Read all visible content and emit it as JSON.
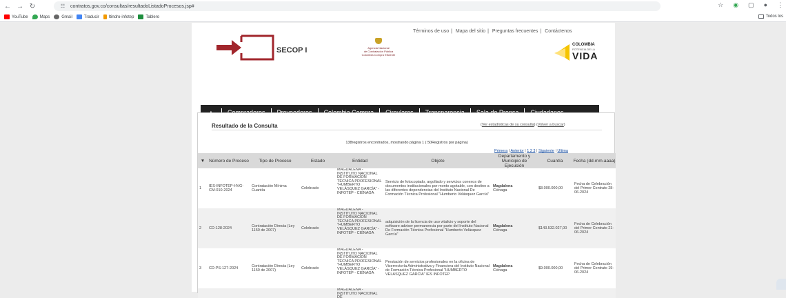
{
  "browser": {
    "url": "contratos.gov.co/consultas/resultadoListadoProcesos.jsp#",
    "bookmarks": [
      "YouTube",
      "Maps",
      "Gmail",
      "Traducir",
      "Itindro-infotep",
      "Tablero"
    ],
    "other_bookmarks": "Todos los"
  },
  "header": {
    "links": [
      "Términos de uso",
      "Mapa del sitio",
      "Preguntas frecuentes",
      "Contáctenos"
    ],
    "logo_text": "SECOP I",
    "agency": [
      "Agencia Nacional",
      "de Contratación Pública",
      "Colombia Compra Eficiente"
    ],
    "brand_word": "COLOMBIA",
    "brand_sub": "POTENCIA DE LA",
    "brand_vida": "VIDA"
  },
  "menu": [
    "Compradores",
    "Proveedores",
    "Colombia Compra",
    "Circulares",
    "Transparencia",
    "Sala de Prensa",
    "Ciudadanos"
  ],
  "result": {
    "title": "Resultado de la Consulta",
    "stats_link": "Ver estadísticas de su consulta",
    "search_link": "Volver a buscar",
    "count": "138registros encontrados, mostrando página 1 ( 50Registros por página)",
    "pager": {
      "first": "Primera",
      "prev": "Anterior",
      "pages": "1 2 3",
      "next": "Siguiente",
      "last": "Ultima"
    },
    "columns": [
      "Número de Proceso",
      "Tipo de Proceso",
      "Estado",
      "Entidad",
      "Objeto",
      "Departamento y Municipio de Ejecución",
      "Cuantía",
      "Fecha (dd-mm-aaaa)"
    ],
    "rows": [
      {
        "n": "1",
        "numero": "IES-INFOTEP-HVG-CM-010-2024",
        "tipo": "Contratación Mínima Cuantía",
        "estado": "Celebrado",
        "entidad": "MAGDALENA - INSTITUTO NACIONAL DE FORMACIÓN TÉCNICA PROFESIONAL \"HUMBERTO VELÁSQUEZ GARCÍA\" - INFOTEP - CIÉNAGA",
        "objeto": "Servicio de fotocopiado, argollado y servicios conexos de documentos institucionales por monto agotable, con destino a las diferentes dependencias del Instituto Nacional De Formación Técnica Profesional \"Humberto Velásquez García\"",
        "depto": "Magdalena",
        "municipio": "Ciénaga",
        "cuantia": "$8.000.000,00",
        "fecha": "Fecha de Celebración del Primer Contrato 28-06-2024"
      },
      {
        "n": "2",
        "numero": "CD-128-2024",
        "tipo": "Contratación Directa (Ley 1150 de 2007)",
        "estado": "Celebrado",
        "entidad": "MAGDALENA - INSTITUTO NACIONAL DE FORMACIÓN TÉCNICA PROFESIONAL \"HUMBERTO VELÁSQUEZ GARCÍA\" - INFOTEP - CIÉNAGA",
        "objeto": "adquisición de la licencia de uso vitalicio y soporte del software adviser permanencia por parte del Instituto Nacional De Formación Técnica Profesional \"Humberto Velásquez García\"",
        "depto": "Magdalena",
        "municipio": "Ciénaga",
        "cuantia": "$143.532.027,00",
        "fecha": "Fecha de Celebración del Primer Contrato 21-06-2024"
      },
      {
        "n": "3",
        "numero": "CD-PS-127-2024",
        "tipo": "Contratación Directa (Ley 1150 de 2007)",
        "estado": "Celebrado",
        "entidad": "MAGDALENA - INSTITUTO NACIONAL DE FORMACIÓN TÉCNICA PROFESIONAL \"HUMBERTO VELÁSQUEZ GARCÍA\" - INFOTEP - CIÉNAGA",
        "objeto": "Prestación de servicios profesionales en la oficina de Vicerrectoría Administrativa y Financiera del Instituto Nacional de Formación Técnica Profesional \"HUMBERTO VELÁSQUEZ GARCÍA\" IES INFOTEP",
        "depto": "Magdalena",
        "municipio": "Ciénaga",
        "cuantia": "$9.000.000,00",
        "fecha": "Fecha de Celebración del Primer Contrato 19-06-2024"
      },
      {
        "n": "",
        "numero": "",
        "tipo": "",
        "estado": "",
        "entidad": "MAGDALENA - INSTITUTO NACIONAL DE",
        "objeto": "",
        "depto": "",
        "municipio": "",
        "cuantia": "",
        "fecha": ""
      }
    ]
  },
  "colors": {
    "menu_bg": "#222222",
    "brand_red": "#a1262c",
    "brand_yellow": "#f5c400"
  }
}
